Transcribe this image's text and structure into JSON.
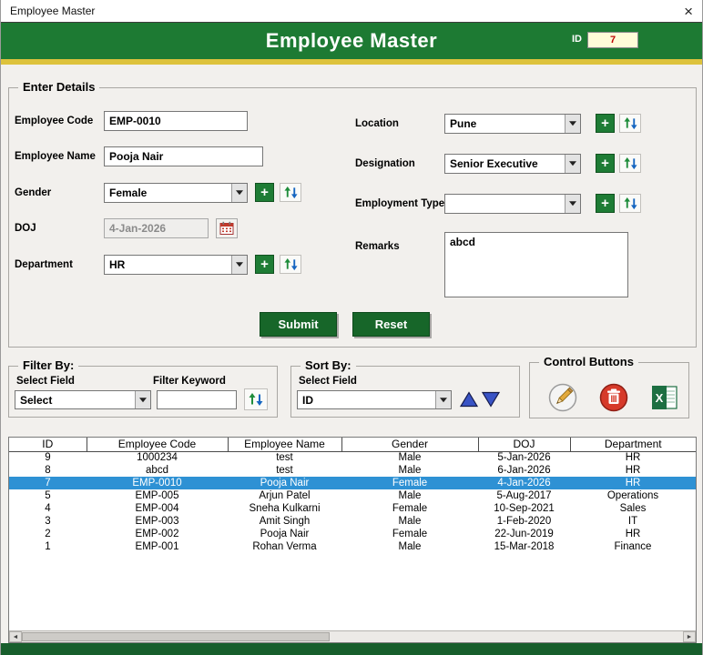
{
  "window": {
    "title": "Employee Master"
  },
  "header": {
    "title": "Employee Master",
    "id_label": "ID",
    "id_value": "7"
  },
  "icons": {
    "close": "×",
    "plus": "+",
    "scroll_left": "◄",
    "scroll_right": "►"
  },
  "details": {
    "legend": "Enter Details",
    "employee_code_label": "Employee Code",
    "employee_code_value": "EMP-0010",
    "employee_name_label": "Employee Name",
    "employee_name_value": "Pooja Nair",
    "gender_label": "Gender",
    "gender_value": "Female",
    "doj_label": "DOJ",
    "doj_value": "4-Jan-2026",
    "department_label": "Department",
    "department_value": "HR",
    "location_label": "Location",
    "location_value": "Pune",
    "designation_label": "Designation",
    "designation_value": "Senior Executive",
    "employment_type_label": "Employment Type",
    "employment_type_value": "",
    "remarks_label": "Remarks",
    "remarks_value": "abcd",
    "submit_label": "Submit",
    "reset_label": "Reset"
  },
  "filter": {
    "legend": "Filter By:",
    "field_label": "Select Field",
    "keyword_label": "Filter Keyword",
    "field_value": "Select",
    "keyword_value": ""
  },
  "sort": {
    "legend": "Sort By:",
    "field_label": "Select Field",
    "field_value": "ID"
  },
  "controls": {
    "legend": "Control Buttons"
  },
  "table": {
    "headers": [
      "ID",
      "Employee Code",
      "Employee Name",
      "Gender",
      "DOJ",
      "Department"
    ],
    "rows": [
      [
        "9",
        "1000234",
        "test",
        "Male",
        "5-Jan-2026",
        "HR"
      ],
      [
        "8",
        "abcd",
        "test",
        "Male",
        "6-Jan-2026",
        "HR"
      ],
      [
        "7",
        "EMP-0010",
        "Pooja Nair",
        "Female",
        "4-Jan-2026",
        "HR"
      ],
      [
        "5",
        "EMP-005",
        "Arjun Patel",
        "Male",
        "5-Aug-2017",
        "Operations"
      ],
      [
        "4",
        "EMP-004",
        "Sneha Kulkarni",
        "Female",
        "10-Sep-2021",
        "Sales"
      ],
      [
        "3",
        "EMP-003",
        "Amit Singh",
        "Male",
        "1-Feb-2020",
        "IT"
      ],
      [
        "2",
        "EMP-002",
        "Pooja Nair",
        "Female",
        "22-Jun-2019",
        "HR"
      ],
      [
        "1",
        "EMP-001",
        "Rohan Verma",
        "Male",
        "15-Mar-2018",
        "Finance"
      ]
    ],
    "selected_index": 2
  },
  "colors": {
    "header-green": "#1d7a33",
    "accent-gold": "#ddc23c",
    "button-green": "#176629",
    "plus-green": "#1e7c35",
    "selected-row-blue": "#2e91d4",
    "footer-green": "#175e2c",
    "id-box-bg": "#fffcd8",
    "id-text-red": "#c00000"
  }
}
